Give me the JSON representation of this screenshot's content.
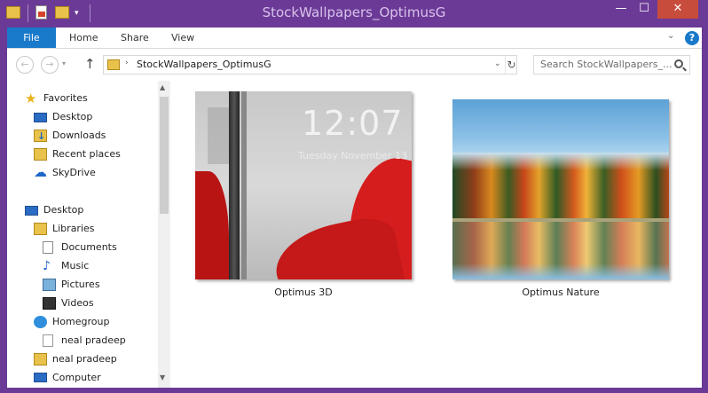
{
  "window": {
    "title": "StockWallpapers_OptimusG",
    "minimize": "—",
    "maximize": "☐",
    "close": "✕"
  },
  "quick_access": {
    "dropdown": "▾"
  },
  "ribbon": {
    "tabs": [
      {
        "label": "File",
        "active": true
      },
      {
        "label": "Home"
      },
      {
        "label": "Share"
      },
      {
        "label": "View"
      }
    ],
    "expand": "⌄",
    "help": "?"
  },
  "address_bar": {
    "back": "←",
    "forward": "→",
    "recent": "▾",
    "up": "↑",
    "path_separator": "›",
    "path": "StockWallpapers_OptimusG",
    "dropdown": "⌄",
    "refresh": "↻",
    "search_placeholder": "Search StockWallpapers_..."
  },
  "nav_pane": {
    "items": [
      {
        "label": "Favorites",
        "icon": "star-icon"
      },
      {
        "label": "Desktop",
        "icon": "desktop-icon"
      },
      {
        "label": "Downloads",
        "icon": "downloads-icon"
      },
      {
        "label": "Recent places",
        "icon": "recent-places-icon"
      },
      {
        "label": "SkyDrive",
        "icon": "cloud-icon"
      },
      {
        "label": "Desktop",
        "icon": "desktop-icon"
      },
      {
        "label": "Libraries",
        "icon": "libraries-icon"
      },
      {
        "label": "Documents",
        "icon": "documents-icon"
      },
      {
        "label": "Music",
        "icon": "music-icon"
      },
      {
        "label": "Pictures",
        "icon": "pictures-icon"
      },
      {
        "label": "Videos",
        "icon": "videos-icon"
      },
      {
        "label": "Homegroup",
        "icon": "homegroup-icon"
      },
      {
        "label": "neal pradeep",
        "icon": "user-icon"
      },
      {
        "label": "neal pradeep",
        "icon": "user-folder-icon"
      },
      {
        "label": "Computer",
        "icon": "computer-icon"
      }
    ],
    "scroll_up": "▲",
    "scroll_down": "▼"
  },
  "content": {
    "files": [
      {
        "name": "Optimus 3D",
        "clock": "12:07",
        "date": "Tuesday November 13"
      },
      {
        "name": "Optimus Nature"
      }
    ]
  },
  "colors": {
    "titlebar": "#6b3a96",
    "file_tab": "#1979ca",
    "close_button": "#c74c3c"
  }
}
